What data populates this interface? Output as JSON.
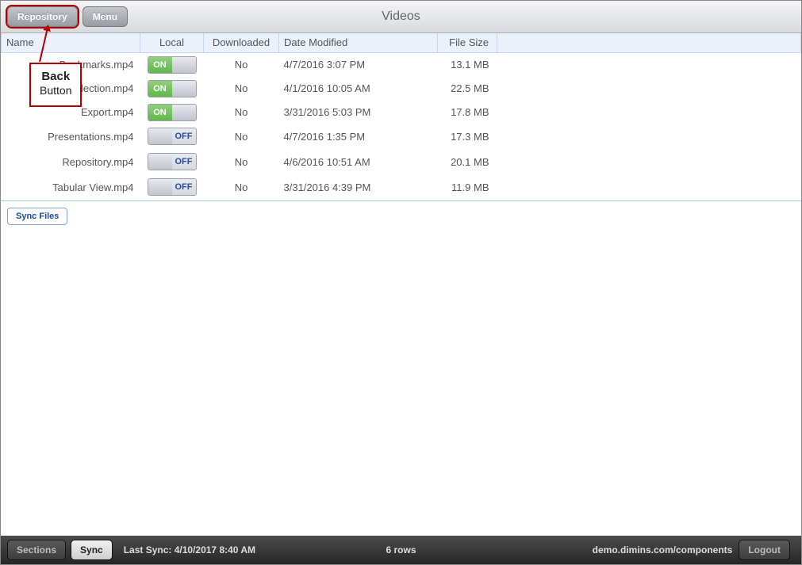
{
  "header": {
    "back_label": "Repository",
    "menu_label": "Menu",
    "title": "Videos"
  },
  "callout": {
    "line1": "Back",
    "line2": "Button"
  },
  "columns": {
    "name": "Name",
    "local": "Local",
    "downloaded": "Downloaded",
    "date": "Date Modified",
    "size": "File Size"
  },
  "toggle": {
    "on": "ON",
    "off": "OFF"
  },
  "rows": [
    {
      "name": "Bookmarks.mp4",
      "local": true,
      "downloaded": "No",
      "date": "4/7/2016 3:07 PM",
      "size": "13.1 MB"
    },
    {
      "name": "Column Selection.mp4",
      "local": true,
      "downloaded": "No",
      "date": "4/1/2016 10:05 AM",
      "size": "22.5 MB"
    },
    {
      "name": "Export.mp4",
      "local": true,
      "downloaded": "No",
      "date": "3/31/2016 5:03 PM",
      "size": "17.8 MB"
    },
    {
      "name": "Presentations.mp4",
      "local": false,
      "downloaded": "No",
      "date": "4/7/2016 1:35 PM",
      "size": "17.3 MB"
    },
    {
      "name": "Repository.mp4",
      "local": false,
      "downloaded": "No",
      "date": "4/6/2016 10:51 AM",
      "size": "20.1 MB"
    },
    {
      "name": "Tabular View.mp4",
      "local": false,
      "downloaded": "No",
      "date": "3/31/2016 4:39 PM",
      "size": "11.9 MB"
    }
  ],
  "actions": {
    "sync_files": "Sync Files"
  },
  "footer": {
    "sections": "Sections",
    "sync": "Sync",
    "last_sync": "Last Sync: 4/10/2017 8:40 AM",
    "row_count": "6 rows",
    "domain": "demo.dimins.com/components",
    "logout": "Logout"
  }
}
